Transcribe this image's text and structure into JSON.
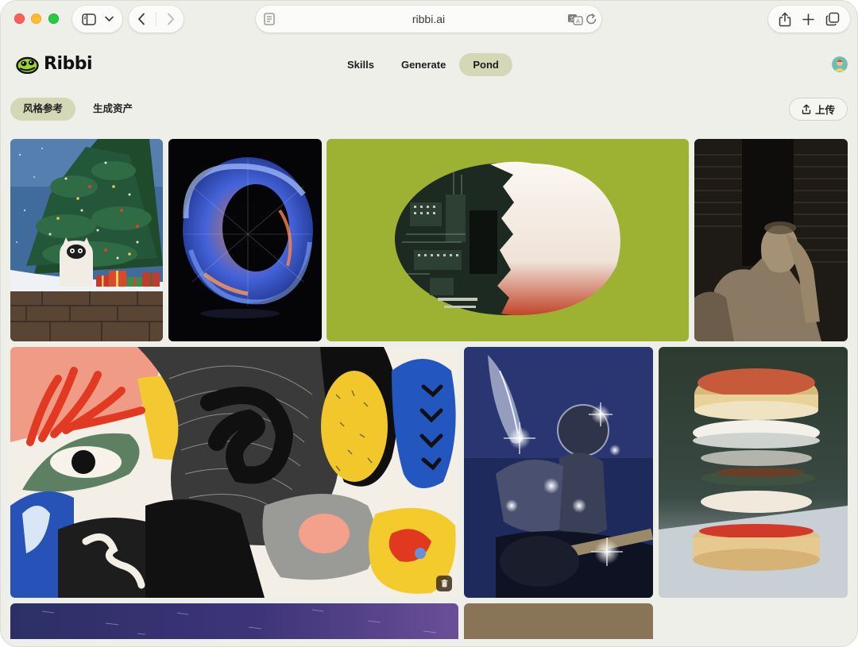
{
  "browser": {
    "url": "ribbi.ai",
    "icons": [
      "sidebar-icon",
      "chevron-down-icon",
      "back-icon",
      "forward-icon",
      "reader-icon",
      "translate-icon",
      "reload-icon",
      "share-icon",
      "plus-icon",
      "tabs-icon"
    ]
  },
  "app": {
    "logo_text": "Ribbi",
    "nav": [
      {
        "label": "Skills",
        "active": false
      },
      {
        "label": "Generate",
        "active": false
      },
      {
        "label": "Pond",
        "active": true
      }
    ],
    "accent_color": "#d4d8b7"
  },
  "subtabs": [
    {
      "label": "风格参考",
      "active": true
    },
    {
      "label": "生成资产",
      "active": false
    }
  ],
  "upload_label": "上传",
  "gallery": [
    {
      "id": "tile-christmas-tree",
      "subject": "christmas-tree-cat"
    },
    {
      "id": "tile-glass-ring",
      "subject": "glowing-ring"
    },
    {
      "id": "tile-circuit-egg",
      "subject": "circuit-egg"
    },
    {
      "id": "tile-statue",
      "subject": "thinking-statue"
    },
    {
      "id": "tile-abstract-ear",
      "subject": "abstract-ear-collage"
    },
    {
      "id": "tile-disco-guitar",
      "subject": "mirror-ball-guitarist"
    },
    {
      "id": "tile-burger",
      "subject": "floating-burger"
    },
    {
      "id": "tile-night-sky",
      "subject": "night-sky"
    },
    {
      "id": "tile-brown",
      "subject": "brown-texture"
    }
  ]
}
